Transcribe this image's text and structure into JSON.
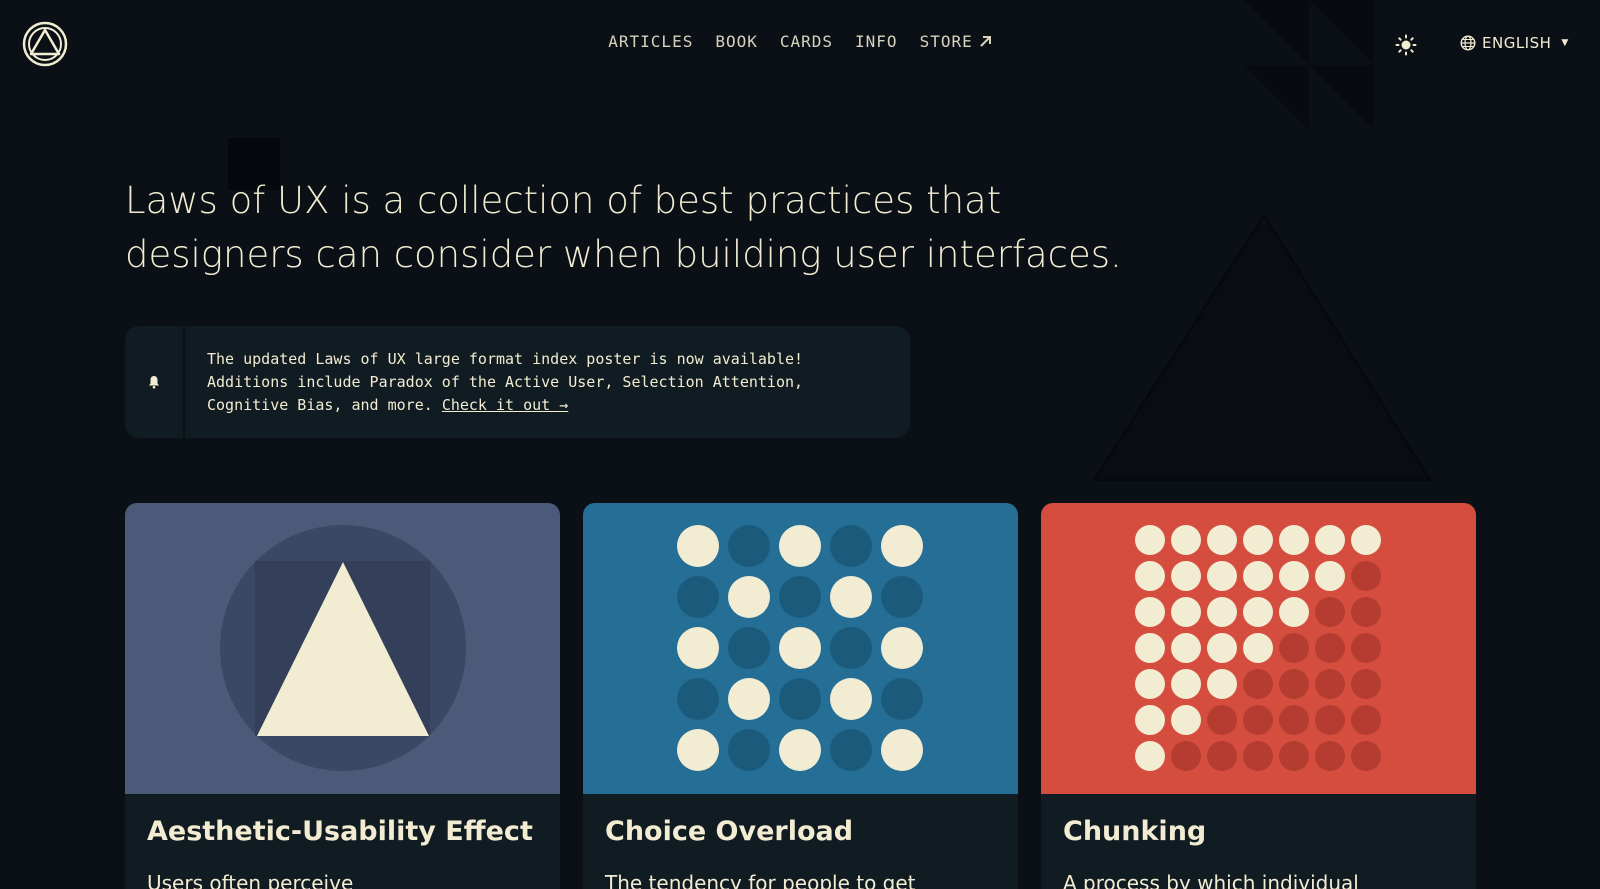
{
  "header": {
    "nav": [
      {
        "label": "ARTICLES"
      },
      {
        "label": "BOOK"
      },
      {
        "label": "CARDS"
      },
      {
        "label": "INFO"
      },
      {
        "label": "STORE"
      }
    ],
    "language": "ENGLISH"
  },
  "hero": {
    "line1": "Laws of UX is a collection of best practices that",
    "line2": "designers can consider when building user interfaces."
  },
  "notice": {
    "line1": "The updated Laws of UX large format index poster is now available!",
    "line2": "Additions include Paradox of the Active User, Selection Attention,",
    "line3": "Cognitive Bias, and more.",
    "link": "Check it out →"
  },
  "cards": [
    {
      "title": "Aesthetic-Usability Effect",
      "excerpt": "Users often perceive",
      "color": "#4a5a78"
    },
    {
      "title": "Choice Overload",
      "excerpt": "The tendency for people to get",
      "color": "#256e96"
    },
    {
      "title": "Chunking",
      "excerpt": "A process by which individual",
      "color": "#d44d3f"
    }
  ],
  "colors": {
    "background": "#0b1016",
    "text": "#f2ecd2",
    "panel": "#111b22"
  }
}
